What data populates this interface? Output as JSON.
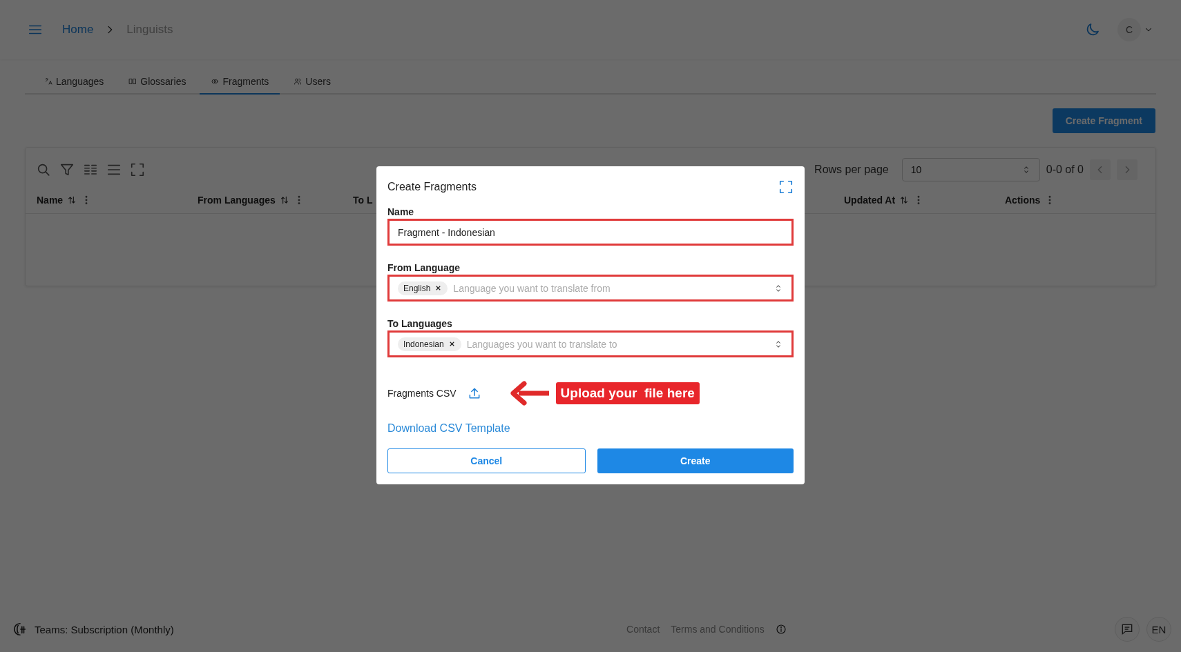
{
  "breadcrumb": [
    "Home",
    "Linguists"
  ],
  "user": {
    "initial": "C"
  },
  "tabs": [
    {
      "label": "Languages",
      "selected": false
    },
    {
      "label": "Glossaries",
      "selected": false
    },
    {
      "label": "Fragments",
      "selected": true
    },
    {
      "label": "Users",
      "selected": false
    }
  ],
  "create_button": "Create Fragment",
  "table": {
    "rows_per_page_label": "Rows per page",
    "rows_per_page": "10",
    "range": "0-0 of 0",
    "columns": [
      {
        "label": "Name",
        "sortable": true,
        "menu": true
      },
      {
        "label": "From Languages",
        "sortable": true,
        "menu": true
      },
      {
        "label": "To L",
        "sortable": false,
        "menu": false
      },
      {
        "label": "Updated At",
        "sortable": true,
        "menu": true
      },
      {
        "label": "Actions",
        "sortable": false,
        "menu": true
      }
    ]
  },
  "dialog": {
    "title": "Create Fragments",
    "fields": [
      {
        "kind": "text",
        "label": "Name",
        "value": "Fragment - Indonesian",
        "highlighted": true
      },
      {
        "kind": "multiselect",
        "label": "From Language",
        "chips": [
          "English"
        ],
        "placeholder": "Language you want to translate from",
        "highlighted": true
      },
      {
        "kind": "multiselect",
        "label": "To Languages",
        "chips": [
          "Indonesian"
        ],
        "placeholder": "Languages you want to translate to",
        "highlighted": true
      }
    ],
    "upload_label": "Fragments CSV",
    "annotation": "Upload your  file here",
    "download_link": "Download CSV Template",
    "buttons": [
      {
        "label": "Cancel",
        "kind": "outlined"
      },
      {
        "label": "Create",
        "kind": "primary"
      }
    ]
  },
  "footer": {
    "plan": "Teams: Subscription (Monthly)",
    "links": [
      "Contact",
      "Terms and Conditions"
    ],
    "language": "EN"
  }
}
